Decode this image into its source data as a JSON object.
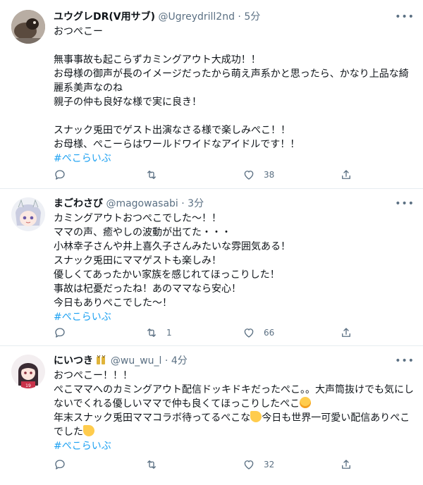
{
  "tweets": [
    {
      "name": "ユウグレDR(V用サブ)",
      "handle": "@Ugreydrill2nd",
      "sep": "·",
      "time": "5分",
      "lines": [
        "おつぺこー",
        "",
        "無事事故も起こらずカミングアウト大成功！！",
        "お母様の御声が長のイメージだったから萌え声系かと思ったら、かなり上品な綺麗系美声なのね",
        "親子の仲も良好な様で実に良き！",
        "",
        "スナック兎田でゲスト出演なさる様で楽しみぺこ！！",
        "お母様、ぺこーらはワールドワイドなアイドルです！！"
      ],
      "hashtag": "#ぺこらいぶ",
      "replies": "",
      "retweets": "",
      "likes": "38"
    },
    {
      "name": "まごわさび",
      "handle": "@magowasabi",
      "sep": "·",
      "time": "3分",
      "lines": [
        "カミングアウトおつぺこでした〜！！",
        "ママの声、癒やしの波動が出てた・・・",
        "小林幸子さんや井上喜久子さんみたいな雰囲気ある！",
        "スナック兎田にママゲストも楽しみ！",
        "優しくてあったかい家族を感じれてほっこりした！",
        "事故は杞憂だったね！あのママなら安心！",
        "今日もありぺこでした〜！"
      ],
      "hashtag": "#ぺこらいぶ",
      "replies": "",
      "retweets": "1",
      "likes": "66"
    },
    {
      "name": "にいつき",
      "handle": "@wu_wu_l",
      "sep": "·",
      "time": "4分",
      "lines": [
        "おつぺこー！！！",
        "ぺこママへのカミングアウト配信ドッキドキだったぺこ。。大声筒抜けでも気にしないでくれる優しいママで仲も良くてほっこりしたぺこ",
        "年末スナック兎田ママコラボ待ってるぺこな",
        "今日も世界一可愛い配信ありぺこでした"
      ],
      "hashtag": "#ぺこらいぶ",
      "replies": "",
      "retweets": "",
      "likes": "32"
    }
  ],
  "colors": {
    "accent": "#1da1f2",
    "secondary_text": "#5b7083",
    "divider": "#e6ecf0"
  },
  "icons": [
    "more-icon",
    "reply-icon",
    "retweet-icon",
    "like-icon",
    "share-icon",
    "verified-badge-icon",
    "smiling-emoji-icon",
    "party-emoji-icon"
  ]
}
